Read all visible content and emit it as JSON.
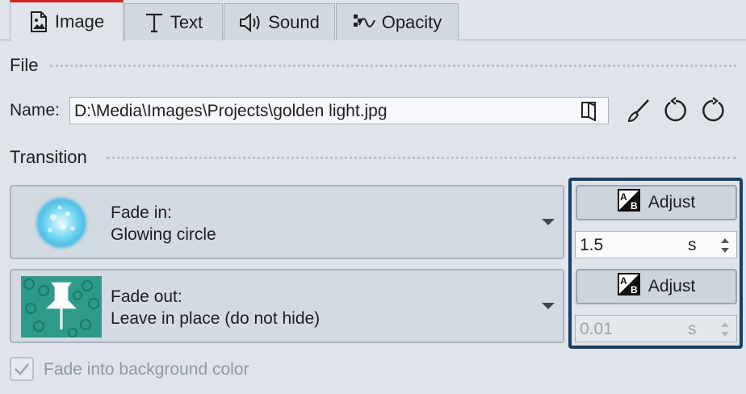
{
  "tabs": [
    {
      "label": "Image",
      "icon": "image-icon",
      "active": true
    },
    {
      "label": "Text",
      "icon": "text-icon",
      "active": false
    },
    {
      "label": "Sound",
      "icon": "speaker-icon",
      "active": false
    },
    {
      "label": "Opacity",
      "icon": "opacity-wave-icon",
      "active": false
    }
  ],
  "file": {
    "section_title": "File",
    "name_label": "Name:",
    "path_value": "D:\\Media\\Images\\Projects\\golden light.jpg",
    "tools": [
      "browse-folder-icon",
      "brush-icon",
      "rotate-left-icon",
      "rotate-right-icon"
    ]
  },
  "transition": {
    "section_title": "Transition",
    "fade_in": {
      "label": "Fade in:",
      "value": "Glowing circle",
      "thumb": "glowing-circle-thumbnail"
    },
    "fade_out": {
      "label": "Fade out:",
      "value": "Leave in place (do not hide)",
      "thumb": "pushpin-thumbnail"
    }
  },
  "panel": {
    "adjust_in_label": "Adjust",
    "duration_in": "1.5",
    "duration_in_unit": "s",
    "adjust_out_label": "Adjust",
    "duration_out": "0.01",
    "duration_out_unit": "s",
    "duration_out_disabled": true
  },
  "background_option": {
    "label": "Fade into background color",
    "checked": true,
    "disabled": true
  },
  "colors": {
    "active_tab_accent": "#c62828",
    "panel_border": "#1a3f66",
    "window_background": "#dfe4ea"
  }
}
